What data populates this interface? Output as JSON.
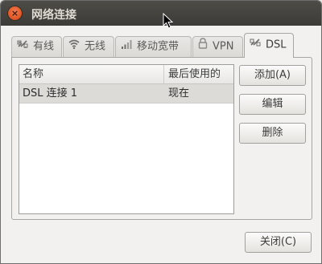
{
  "window": {
    "title": "网络连接",
    "close_glyph": "×"
  },
  "tabs": [
    {
      "label": "有线",
      "icon": "wired-icon",
      "active": false
    },
    {
      "label": "无线",
      "icon": "wireless-icon",
      "active": false
    },
    {
      "label": "移动宽带",
      "icon": "signal-bars-icon",
      "active": false
    },
    {
      "label": "VPN",
      "icon": "lock-icon",
      "active": false
    },
    {
      "label": "DSL",
      "icon": "wired-icon",
      "active": true
    }
  ],
  "list": {
    "columns": [
      "名称",
      "最后使用的"
    ],
    "rows": [
      {
        "name": "DSL 连接 1",
        "last_used": "现在",
        "selected": true
      }
    ]
  },
  "actions": {
    "add": "添加(A)",
    "edit": "编辑",
    "delete": "删除"
  },
  "footer": {
    "close": "关闭(C)"
  },
  "colors": {
    "titlebar": "#3c3b37",
    "close_button": "#e25a28",
    "selected_row": "#dcdbd8"
  }
}
